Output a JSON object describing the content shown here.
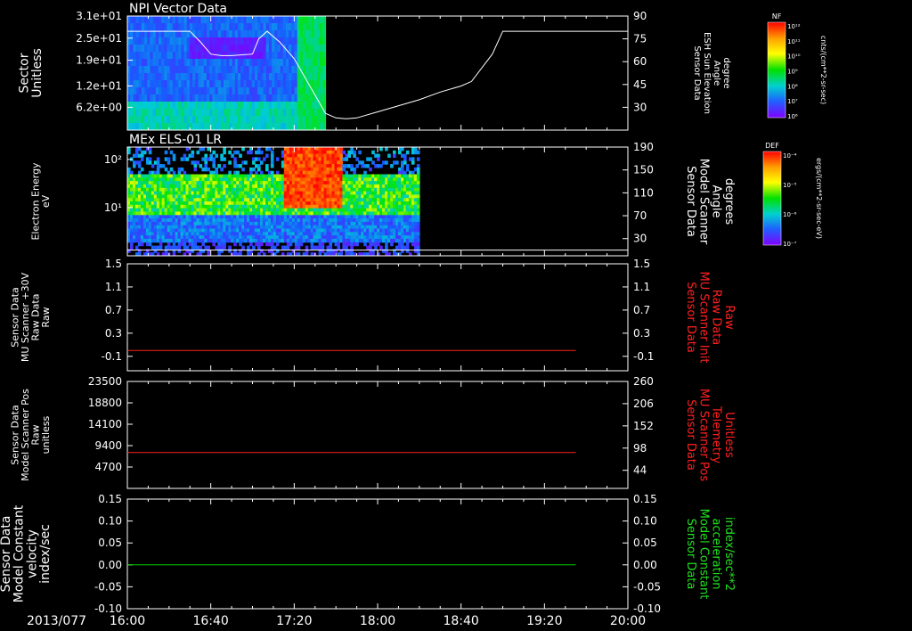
{
  "date_label": "2013/077",
  "time_axis": {
    "start": "16:00",
    "end": "20:00",
    "tick_labels": [
      "16:00",
      "16:40",
      "17:20",
      "18:00",
      "18:40",
      "19:20",
      "20:00"
    ]
  },
  "colors": {
    "background": "#000000",
    "axes": "#ffffff",
    "trace_white": "#ffffff",
    "trace_red": "#ff2020",
    "trace_green": "#00d000",
    "label_red": "#ff2020",
    "label_green": "#20e020"
  },
  "chart_data": [
    {
      "type": "heatmap",
      "title": "NPI Vector Data",
      "left_axis": {
        "label_lines": [
          "Sector",
          "Unitless"
        ],
        "tick_labels": [
          "3.1e+01",
          "2.5e+01",
          "1.9e+01",
          "1.2e+01",
          "6.2e+00"
        ],
        "tick_values": [
          31,
          25,
          19,
          12,
          6.2
        ],
        "ylim": [
          0,
          31
        ]
      },
      "right_axis": {
        "label_lines": [
          "Sensor Data",
          "ESH Sun Elevation",
          "Angle",
          "degree"
        ],
        "tick_labels": [
          "90",
          "75",
          "60",
          "45",
          "30"
        ],
        "tick_values": [
          90,
          75,
          60,
          45,
          30
        ],
        "ylim": [
          15,
          90
        ]
      },
      "data_extent": {
        "start": "16:00",
        "end": "17:35"
      },
      "overlay_series": {
        "name": "ESH Sun Elevation Angle",
        "x": [
          "16:00",
          "16:30",
          "16:35",
          "16:40",
          "16:45",
          "16:50",
          "17:00",
          "17:03",
          "17:07",
          "17:13",
          "17:20",
          "17:35",
          "17:40",
          "17:45",
          "17:50",
          "18:00",
          "18:20",
          "18:30",
          "18:40",
          "18:45",
          "18:55",
          "19:00",
          "19:20",
          "19:40",
          "20:00"
        ],
        "y": [
          80,
          80,
          73,
          65,
          64,
          64,
          65,
          75,
          80,
          73,
          62,
          26,
          23,
          22.5,
          23,
          27,
          35,
          40,
          44,
          47,
          65,
          80,
          80,
          80,
          80
        ]
      },
      "colorbar": {
        "title": "NF",
        "units": "cnts/(cm**2-sr-sec)",
        "tick_labels": [
          "10¹²",
          "10¹¹",
          "10¹⁰",
          "10⁹",
          "10⁸",
          "10⁷",
          "10⁶"
        ]
      }
    },
    {
      "type": "heatmap",
      "title": "MEx ELS-01 LR",
      "left_axis": {
        "label_lines": [
          "Electron Energy",
          "eV"
        ],
        "scale": "log",
        "tick_labels": [
          "10²",
          "10¹"
        ],
        "tick_values": [
          100,
          10
        ],
        "ylim": [
          1,
          180
        ]
      },
      "right_axis": {
        "label_lines": [
          "Sensor Data",
          "Model Scanner",
          "Angle",
          "degrees"
        ],
        "tick_labels": [
          "190",
          "150",
          "110",
          "70",
          "30"
        ],
        "tick_values": [
          190,
          150,
          110,
          70,
          30
        ],
        "ylim": [
          0,
          190
        ]
      },
      "data_extent": {
        "start": "16:00",
        "end": "18:20"
      },
      "overlay_series": {
        "name": "Model Scanner Angle",
        "x": [
          "16:00",
          "20:00"
        ],
        "y": [
          10,
          10
        ]
      },
      "colorbar": {
        "title": "DEF",
        "units": "ergs/(cm**2-sr-sec-eV)",
        "tick_labels": [
          "10⁻⁴",
          "10⁻⁵",
          "10⁻⁶",
          "10⁻⁷"
        ]
      }
    },
    {
      "type": "line",
      "title": "",
      "left_axis": {
        "label_lines": [
          "Sensor Data",
          "MU Scanner +30V",
          "Raw Data",
          "Raw"
        ],
        "tick_labels": [
          "1.5",
          "1.1",
          "0.7",
          "0.3",
          "-0.1"
        ],
        "tick_values": [
          1.5,
          1.1,
          0.7,
          0.3,
          -0.1
        ],
        "ylim": [
          -0.35,
          1.5
        ]
      },
      "right_axis": {
        "label_lines": [
          "Sensor Data",
          "MU Scanner Init",
          "Raw Data",
          "Raw"
        ],
        "tick_labels": [
          "1.5",
          "1.1",
          "0.7",
          "0.3",
          "-0.1"
        ],
        "tick_values": [
          1.5,
          1.1,
          0.7,
          0.3,
          -0.1
        ],
        "ylim": [
          -0.35,
          1.5
        ]
      },
      "series": [
        {
          "color": "#ff2020",
          "x": [
            "16:00",
            "19:35"
          ],
          "y": [
            0,
            0
          ]
        }
      ]
    },
    {
      "type": "line",
      "title": "",
      "left_axis": {
        "label_lines": [
          "Sensor Data",
          "Model Scanner Pos",
          "Raw",
          "unitless"
        ],
        "tick_labels": [
          "23500",
          "18800",
          "14100",
          "9400",
          "4700"
        ],
        "tick_values": [
          23500,
          18800,
          14100,
          9400,
          4700
        ],
        "ylim": [
          0,
          23500
        ]
      },
      "right_axis": {
        "label_lines": [
          "Sensor Data",
          "MU Scanner Pos",
          "Telemetry",
          "Unitless"
        ],
        "tick_labels": [
          "260",
          "206",
          "152",
          "98",
          "44"
        ],
        "tick_values": [
          260,
          206,
          152,
          98,
          44
        ],
        "ylim": [
          0,
          260
        ]
      },
      "series": [
        {
          "color": "#ff2020",
          "x": [
            "16:00",
            "19:35"
          ],
          "y": [
            7900,
            7900
          ]
        }
      ]
    },
    {
      "type": "line",
      "title": "",
      "left_axis": {
        "label_lines": [
          "Sensor Data",
          "Model Constant",
          "velocity",
          "index/sec"
        ],
        "tick_labels": [
          "0.15",
          "0.10",
          "0.05",
          "0.00",
          "-0.05",
          "-0.10"
        ],
        "tick_values": [
          0.15,
          0.1,
          0.05,
          0.0,
          -0.05,
          -0.1
        ],
        "ylim": [
          -0.1,
          0.15
        ]
      },
      "right_axis": {
        "label_lines": [
          "Sensor Data",
          "Model Constant",
          "acceleration",
          "index/sec**2"
        ],
        "tick_labels": [
          "0.15",
          "0.10",
          "0.05",
          "0.00",
          "-0.05",
          "-0.10"
        ],
        "tick_values": [
          0.15,
          0.1,
          0.05,
          0.0,
          -0.05,
          -0.1
        ],
        "ylim": [
          -0.1,
          0.15
        ]
      },
      "series": [
        {
          "color": "#00d000",
          "x": [
            "16:00",
            "19:35"
          ],
          "y": [
            0,
            0
          ]
        }
      ]
    }
  ]
}
